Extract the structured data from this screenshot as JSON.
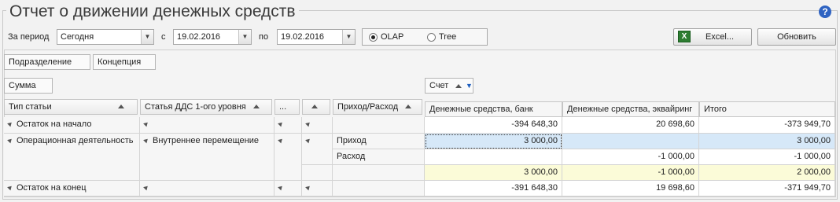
{
  "title": "Отчет о движении денежных средств",
  "help_glyph": "?",
  "filters": {
    "period_label": "За период",
    "period_value": "Сегодня",
    "from_label": "с",
    "from_date": "19.02.2016",
    "to_label": "по",
    "to_date": "19.02.2016",
    "view_modes": [
      {
        "label": "OLAP",
        "selected": true
      },
      {
        "label": "Tree",
        "selected": false
      }
    ]
  },
  "toolbar": {
    "excel_label": "Excel...",
    "refresh_label": "Обновить"
  },
  "pivot": {
    "filter_fields": [
      "Подразделение",
      "Концепция"
    ],
    "data_field": "Сумма",
    "column_field": "Счет",
    "row_headers": [
      "Тип статьи",
      "Статья ДДС 1-ого уровня",
      "...",
      "",
      "Приход/Расход"
    ],
    "column_headers": [
      "Денежные средства, банк",
      "Денежные средства, эквайринг",
      "Итого"
    ],
    "rows": {
      "start": {
        "type": "Остаток на начало",
        "values": [
          "-394 648,30",
          "20 698,60",
          "-373 949,70"
        ]
      },
      "ops_type": "Операционная деятельность",
      "ops_article": "Внутреннее перемещение",
      "income": {
        "label": "Приход",
        "values": [
          "3 000,00",
          "",
          "3 000,00"
        ]
      },
      "expense": {
        "label": "Расход",
        "values": [
          "",
          "-1 000,00",
          "-1 000,00"
        ]
      },
      "subtotal": {
        "values": [
          "3 000,00",
          "-1 000,00",
          "2 000,00"
        ]
      },
      "end": {
        "type": "Остаток на конец",
        "values": [
          "-391 648,30",
          "19 698,60",
          "-371 949,70"
        ]
      }
    }
  }
}
